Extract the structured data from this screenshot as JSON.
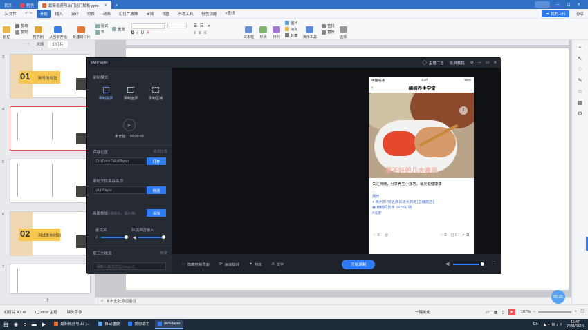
{
  "titlebar": {
    "tabs": [
      "首页",
      "稻壳",
      "最新视频号上门访门解析.pptx"
    ],
    "add": "+",
    "upload": "我的上传",
    "share": "分享",
    "accent": "#2f6fc4"
  },
  "menubar": {
    "file": "三 文件",
    "start": "开始",
    "items": [
      "插入",
      "设计",
      "切换",
      "动画",
      "幻灯片放映",
      "审阅",
      "视图",
      "开发工具",
      "特色功能"
    ],
    "search": "查找"
  },
  "ribbon": {
    "paste": "粘贴",
    "cut": "剪切",
    "copy": "复制",
    "format": "格式刷",
    "from_current": "从当前开始",
    "new_slide": "新建幻灯片",
    "layout": "版式",
    "section": "节",
    "reset": "重置",
    "textbox": "文本框",
    "shape": "形状",
    "arrange": "排列",
    "picture": "图片",
    "fill": "填充",
    "outline": "轮廓",
    "tools": "演示工具",
    "find": "查找",
    "replace": "替换",
    "select": "选择"
  },
  "leftpane": {
    "tab_outline": "大纲",
    "tab_slides": "幻灯片",
    "slides": [
      {
        "num": "3",
        "big": "01",
        "title": "账号的权重"
      },
      {
        "num": "4",
        "big": "",
        "title": ""
      },
      {
        "num": "5",
        "big": "",
        "title": ""
      },
      {
        "num": "6",
        "big": "02",
        "title": "测试发布时间"
      },
      {
        "num": "7",
        "big": "",
        "title": ""
      }
    ],
    "add": "+"
  },
  "airplayer": {
    "title": "iAirPlayer",
    "top_links": [
      "主播广告",
      "投屏教程"
    ],
    "record_mode": "录制模式",
    "modes": [
      "录制投屏",
      "录制全屏",
      "录制区域"
    ],
    "not_started": "未开始",
    "time": "00:00:00",
    "save_location": "保存位置",
    "change_location": "修改位置",
    "save_path": "D:\\iTools7\\iAirPlayer",
    "open": "打开",
    "filename_label": "录制文件保存名称",
    "filename": "iAirPlayer",
    "modify": "修改",
    "overlay_label": "画面叠加",
    "overlay_hint": "(摄像头，图片等)",
    "add": "添加",
    "mic": "麦克风",
    "env": "环境声音录入",
    "third_party": "第三方推流",
    "new": "新建",
    "stream_placeholder": "请输入推流地址(rtmp://)",
    "bottom": {
      "hide_panel": "隐藏控制界面",
      "rotate": "画面旋转",
      "effects": "特效",
      "text": "文字",
      "start_record": "开始录制"
    },
    "accent": "#2f7bf4"
  },
  "phone": {
    "carrier": "中国联通",
    "time": "3:47",
    "battery": "99%",
    "header": "楠楠养生学堂",
    "overlay_text": "那不好的几大表现",
    "desc": "关注楠楠，分享养生小技巧，每天健健康康",
    "more": "展开",
    "location": "赣州市·安远县百货大药房(总铺路店)",
    "product": "楠楠同款茶 167B认购",
    "link": "#关爱",
    "stats": {
      "a": "2",
      "b": "0",
      "c": "11",
      "d": "0"
    }
  },
  "notes": {
    "placeholder": "单击此处添加备注"
  },
  "status": {
    "slide_info": "幻灯片 4 / 18",
    "theme": "1_Office 主题",
    "protect": "缺失字体",
    "beautify": "一键美化",
    "zoom": "107%"
  },
  "badge": "06:30",
  "taskbar": {
    "items": [
      "最新视频号上门...",
      "自动播放",
      "爱思助手",
      "iAirPlayer"
    ],
    "time": "15:47",
    "date": "2020/10/10",
    "lang": "CH"
  }
}
